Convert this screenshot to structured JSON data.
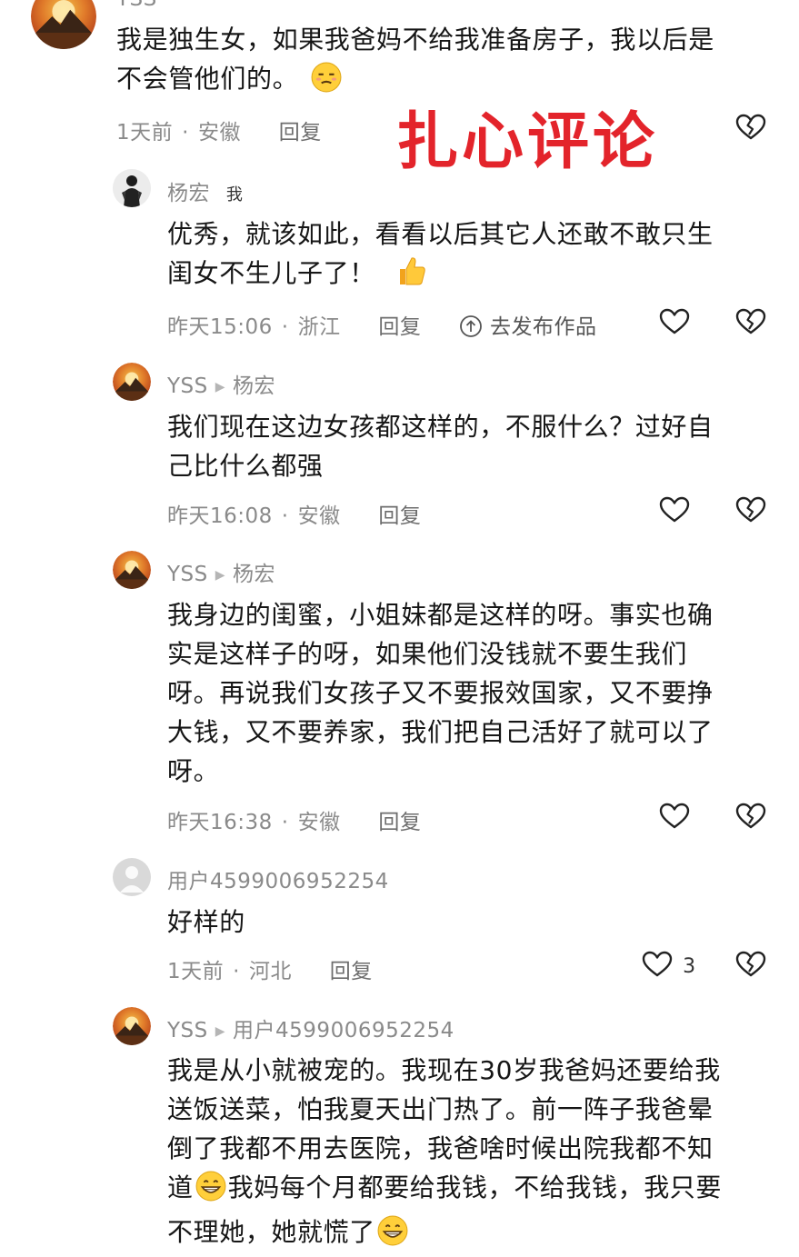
{
  "top_comment": {
    "name_partial": "YSS",
    "text": "我是独生女，如果我爸妈不给我准备房子，我以后是不会管他们的。",
    "text_line1": "我是独生女，如果我爸妈不给我准备房子，我以后是",
    "text_line2": "不会管他们的。",
    "time": "1天前",
    "location": "安徽",
    "reply_label": "回复"
  },
  "overlay_title": "扎心评论",
  "replies": [
    {
      "name": "杨宏",
      "badge": "我",
      "text_line1": "优秀，就该如此，看看以后其它人还敢不敢只生",
      "text_line2": "闺女不生儿子了！",
      "time": "昨天15:06",
      "location": "浙江",
      "reply_label": "回复",
      "publish_label": "去发布作品"
    },
    {
      "name": "YSS",
      "reply_to": "杨宏",
      "text_line1": "我们现在这边女孩都这样的，不服什么？过好自",
      "text_line2": "己比什么都强",
      "time": "昨天16:08",
      "location": "安徽",
      "reply_label": "回复"
    },
    {
      "name": "YSS",
      "reply_to": "杨宏",
      "text_line1": "我身边的闺蜜，小姐妹都是这样的呀。事实也确",
      "text_line2": "实是这样子的呀，如果他们没钱就不要生我们",
      "text_line3": "呀。再说我们女孩子又不要报效国家，又不要挣",
      "text_line4": "大钱，又不要养家，我们把自己活好了就可以了",
      "text_line5": "呀。",
      "time": "昨天16:38",
      "location": "安徽",
      "reply_label": "回复"
    },
    {
      "name": "用户4599006952254",
      "text_line1": "好样的",
      "time": "1天前",
      "location": "河北",
      "reply_label": "回复",
      "like_count": "3"
    },
    {
      "name": "YSS",
      "reply_to": "用户4599006952254",
      "text_line1": "我是从小就被宠的。我现在30岁我爸妈还要给我",
      "text_line2": "送饭送菜，怕我夏天出门热了。前一阵子我爸晕",
      "text_line3": "倒了我都不用去医院，我爸啥时候出院我都不知",
      "text_line4a": "道",
      "text_line4b": "我妈每个月都要给我钱，不给我钱，我只要",
      "text_line5": "不理她，她就慌了"
    }
  ],
  "icons": [
    "sunset-avatar",
    "person-avatar",
    "default-avatar",
    "heart-icon",
    "broken-heart-icon",
    "share-publish-icon",
    "thumbs-up-emoji",
    "smug-emoji",
    "grin-emoji"
  ],
  "colors": {
    "accent_red": "#e3242b",
    "meta_gray": "#8a8a8a"
  }
}
